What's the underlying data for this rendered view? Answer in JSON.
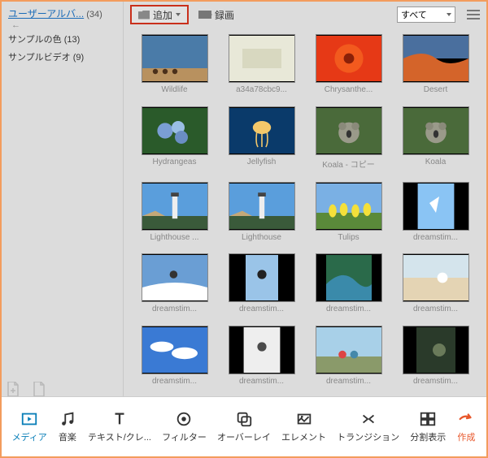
{
  "sidebar": {
    "title": "ユーザーアルバ...",
    "count": "(34)",
    "items": [
      {
        "label": "サンプルの色 (13)"
      },
      {
        "label": "サンプルビデオ (9)"
      }
    ]
  },
  "toolbar": {
    "add_label": "追加",
    "record_label": "録画",
    "filter_label": "すべて"
  },
  "media": [
    {
      "name": "Wildlife",
      "kind": "wildlife"
    },
    {
      "name": "a34a78cbc9...",
      "kind": "bright"
    },
    {
      "name": "Chrysanthe...",
      "kind": "flower-red"
    },
    {
      "name": "Desert",
      "kind": "desert"
    },
    {
      "name": "Hydrangeas",
      "kind": "flower-blue"
    },
    {
      "name": "Jellyfish",
      "kind": "jellyfish"
    },
    {
      "name": "Koala - コピー",
      "kind": "koala"
    },
    {
      "name": "Koala",
      "kind": "koala"
    },
    {
      "name": "Lighthouse ...",
      "kind": "lighthouse"
    },
    {
      "name": "Lighthouse",
      "kind": "lighthouse"
    },
    {
      "name": "Tulips",
      "kind": "tulips"
    },
    {
      "name": "dreamstim...",
      "kind": "ski1"
    },
    {
      "name": "dreamstim...",
      "kind": "ski2"
    },
    {
      "name": "dreamstim...",
      "kind": "ski3"
    },
    {
      "name": "dreamstim...",
      "kind": "wave"
    },
    {
      "name": "dreamstim...",
      "kind": "beach"
    },
    {
      "name": "dreamstim...",
      "kind": "sky"
    },
    {
      "name": "dreamstim...",
      "kind": "sport"
    },
    {
      "name": "dreamstim...",
      "kind": "people"
    },
    {
      "name": "dreamstim...",
      "kind": "dark"
    }
  ],
  "tabs": [
    {
      "label": "メディア",
      "icon": "media",
      "active": true
    },
    {
      "label": "音楽",
      "icon": "music"
    },
    {
      "label": "テキスト/クレ...",
      "icon": "text"
    },
    {
      "label": "フィルター",
      "icon": "filter"
    },
    {
      "label": "オーバーレイ",
      "icon": "overlay"
    },
    {
      "label": "エレメント",
      "icon": "element"
    },
    {
      "label": "トランジション",
      "icon": "transition"
    },
    {
      "label": "分割表示",
      "icon": "split"
    },
    {
      "label": "作成",
      "icon": "create",
      "create": true
    }
  ]
}
